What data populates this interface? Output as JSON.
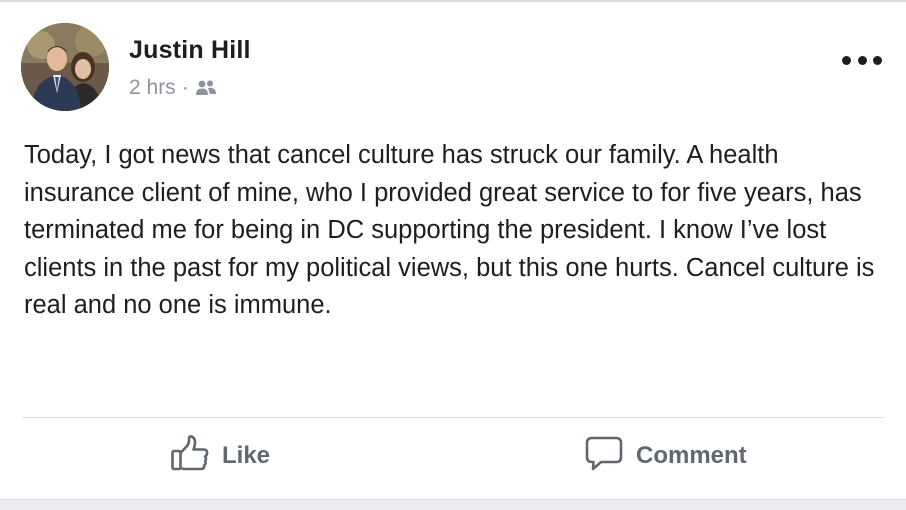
{
  "post": {
    "author": "Justin Hill",
    "timestamp": "2 hrs",
    "separator": "·",
    "audience_icon": "friends-icon",
    "avatar_icon": "profile-photo",
    "more_icon": "ellipsis-icon",
    "text": "Today, I got news that cancel culture has struck our family. A health insurance client of mine, who I provided great service to for five years, has terminated me for being in DC supporting the president. I know I’ve lost clients in the past for my political views, but this one hurts. Cancel culture is real and no one is immune."
  },
  "actions": {
    "like_label": "Like",
    "like_icon": "thumbs-up-icon",
    "comment_label": "Comment",
    "comment_icon": "speech-bubble-icon"
  },
  "colors": {
    "text": "#1c1e21",
    "secondary": "#8d949e",
    "action": "#606770",
    "divider": "#dadde1"
  }
}
